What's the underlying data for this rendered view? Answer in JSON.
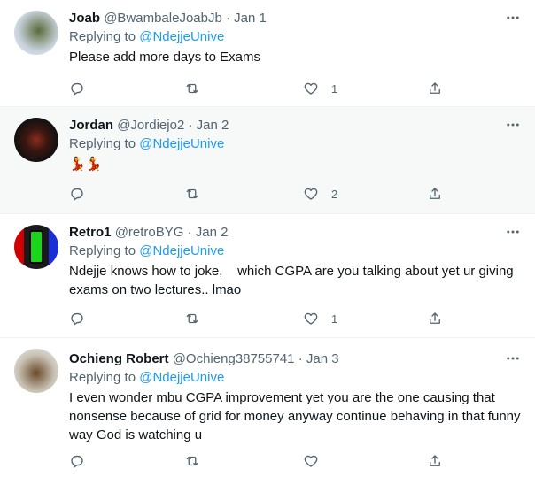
{
  "tweets": [
    {
      "name": "Joab",
      "handle": "@BwambaleJoabJb",
      "date": "Jan 1",
      "replying_prefix": "Replying to ",
      "replying_to": "@NdejjeUnive",
      "text": "Please add more days to Exams",
      "likes": "1"
    },
    {
      "name": "Jordan",
      "handle": "@Jordiejo2",
      "date": "Jan 2",
      "replying_prefix": "Replying to ",
      "replying_to": "@NdejjeUnive",
      "text": "💃💃",
      "likes": "2"
    },
    {
      "name": "Retro1",
      "handle": "@retroBYG",
      "date": "Jan 2",
      "replying_prefix": "Replying to ",
      "replying_to": "@NdejjeUnive",
      "text": "Ndejje knows how to joke,    which CGPA are you talking about yet ur giving exams on two lectures.. lmao",
      "likes": "1"
    },
    {
      "name": "Ochieng Robert",
      "handle": "@Ochieng38755741",
      "date": "Jan 3",
      "replying_prefix": "Replying to ",
      "replying_to": "@NdejjeUnive",
      "text": "I even wonder mbu CGPA improvement yet you are the one causing that nonsense because of grid for money anyway continue behaving in that funny way God is watching u",
      "likes": ""
    }
  ],
  "separator": " · ",
  "icons": {
    "reply": "reply-icon",
    "retweet": "retweet-icon",
    "like": "heart-icon",
    "share": "share-icon",
    "more": "more-icon"
  },
  "colors": {
    "link": "#1d9bf0",
    "muted": "#536471",
    "text": "#0f1419"
  }
}
